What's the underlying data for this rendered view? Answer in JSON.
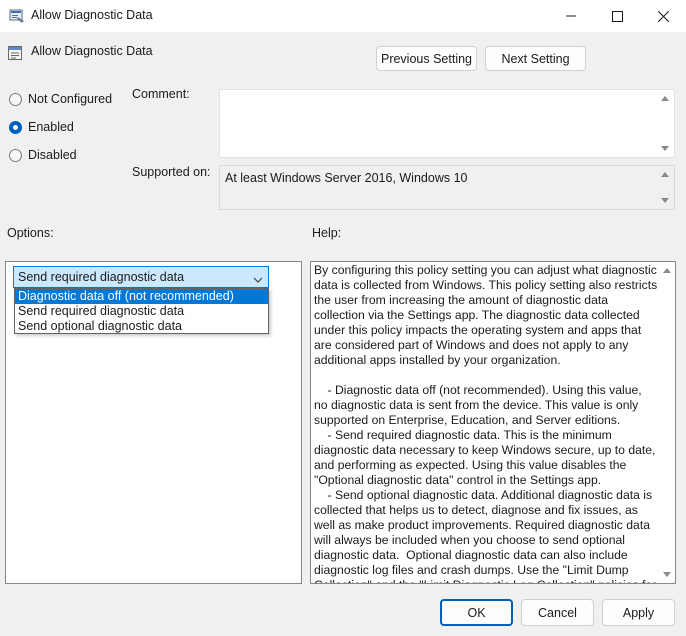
{
  "window": {
    "title": "Allow Diagnostic Data"
  },
  "header": {
    "policy_title": "Allow Diagnostic Data",
    "prev_label": "Previous Setting",
    "next_label": "Next Setting"
  },
  "state": {
    "options": [
      {
        "label": "Not Configured",
        "checked": false
      },
      {
        "label": "Enabled",
        "checked": true
      },
      {
        "label": "Disabled",
        "checked": false
      }
    ]
  },
  "comment": {
    "label": "Comment:",
    "value": ""
  },
  "supported": {
    "label": "Supported on:",
    "value": "At least Windows Server 2016, Windows 10"
  },
  "sections": {
    "options_label": "Options:",
    "help_label": "Help:"
  },
  "options_panel": {
    "selected_value": "Send required diagnostic data",
    "dropdown_items": [
      {
        "label": "Diagnostic data off (not recommended)",
        "highlighted": true
      },
      {
        "label": "Send required diagnostic data",
        "highlighted": false
      },
      {
        "label": "Send optional diagnostic data",
        "highlighted": false
      }
    ]
  },
  "help": {
    "text": "By configuring this policy setting you can adjust what diagnostic data is collected from Windows. This policy setting also restricts the user from increasing the amount of diagnostic data collection via the Settings app. The diagnostic data collected under this policy impacts the operating system and apps that are considered part of Windows and does not apply to any additional apps installed by your organization.\n\n    - Diagnostic data off (not recommended). Using this value, no diagnostic data is sent from the device. This value is only supported on Enterprise, Education, and Server editions.\n    - Send required diagnostic data. This is the minimum diagnostic data necessary to keep Windows secure, up to date, and performing as expected. Using this value disables the \"Optional diagnostic data\" control in the Settings app.\n    - Send optional diagnostic data. Additional diagnostic data is collected that helps us to detect, diagnose and fix issues, as well as make product improvements. Required diagnostic data will always be included when you choose to send optional diagnostic data.  Optional diagnostic data can also include diagnostic log files and crash dumps. Use the \"Limit Dump Collection\" and the \"Limit Diagnostic Log Collection\" policies for more granular control of what optional diagnostic data is sent."
  },
  "footer": {
    "ok_label": "OK",
    "cancel_label": "Cancel",
    "apply_label": "Apply"
  },
  "colors": {
    "accent": "#005fb8",
    "selection": "#0078d7",
    "combo_highlight": "#cce8ff"
  }
}
